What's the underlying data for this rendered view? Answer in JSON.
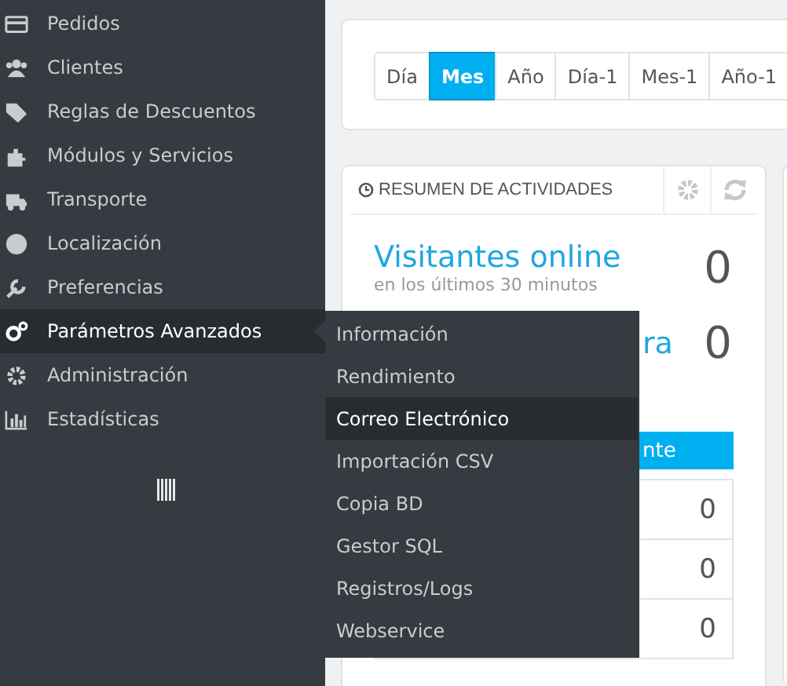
{
  "sidebar": {
    "items": [
      {
        "label": "Pedidos",
        "selected": false
      },
      {
        "label": "Clientes",
        "selected": false
      },
      {
        "label": "Reglas de Descuentos",
        "selected": false
      },
      {
        "label": "Módulos y Servicios",
        "selected": false
      },
      {
        "label": "Transporte",
        "selected": false
      },
      {
        "label": "Localización",
        "selected": false
      },
      {
        "label": "Preferencias",
        "selected": false
      },
      {
        "label": "Parámetros Avanzados",
        "selected": true
      },
      {
        "label": "Administración",
        "selected": false
      },
      {
        "label": "Estadísticas",
        "selected": false
      }
    ]
  },
  "submenu": {
    "items": [
      {
        "label": "Información",
        "selected": false
      },
      {
        "label": "Rendimiento",
        "selected": false
      },
      {
        "label": "Correo Electrónico",
        "selected": true
      },
      {
        "label": "Importación CSV",
        "selected": false
      },
      {
        "label": "Copia BD",
        "selected": false
      },
      {
        "label": "Gestor SQL",
        "selected": false
      },
      {
        "label": "Registros/Logs",
        "selected": false
      },
      {
        "label": "Webservice",
        "selected": false
      }
    ]
  },
  "period_buttons": [
    {
      "label": "Día",
      "selected": false
    },
    {
      "label": "Mes",
      "selected": true
    },
    {
      "label": "Año",
      "selected": false
    },
    {
      "label": "Día-1",
      "selected": false
    },
    {
      "label": "Mes-1",
      "selected": false
    },
    {
      "label": "Año-1",
      "selected": false
    }
  ],
  "activity_card": {
    "title": "RESUMEN DE ACTIVIDADES",
    "metrics": [
      {
        "label": "Visitantes online",
        "sublabel": "en los últimos 30 minutos",
        "value": "0"
      },
      {
        "label": "ra",
        "value": "0"
      }
    ],
    "tab_label": "nte",
    "rows": [
      {
        "value": "0"
      },
      {
        "value": "0"
      },
      {
        "value": "0"
      }
    ]
  }
}
